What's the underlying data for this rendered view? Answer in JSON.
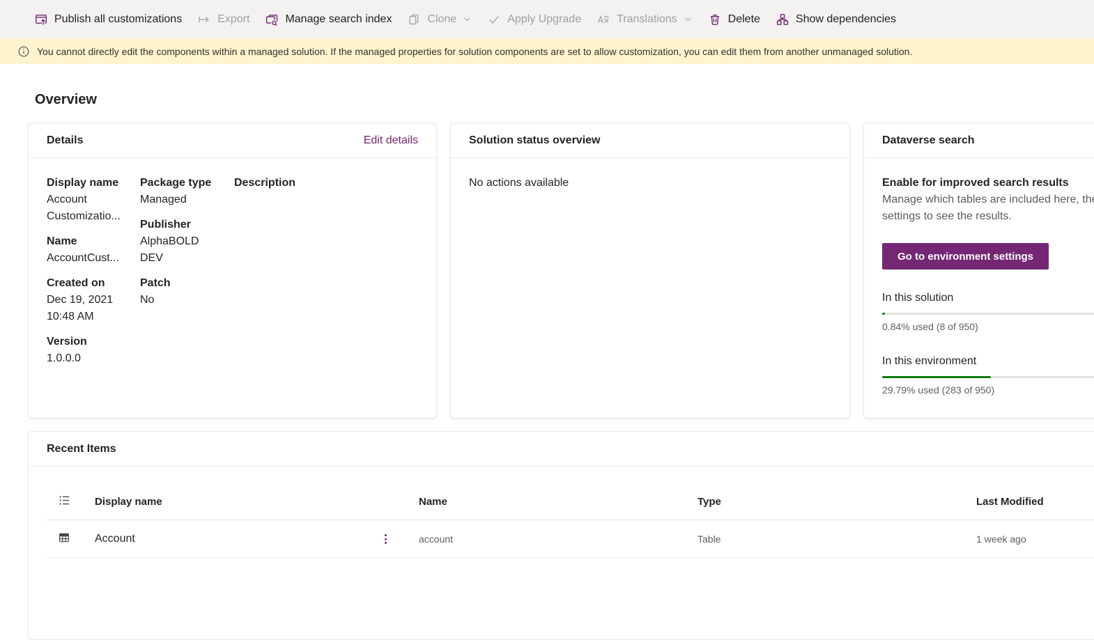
{
  "colors": {
    "accent_purple": "#742774",
    "progress_green": "#107c10",
    "banner_bg": "#fff4ce",
    "toolbar_bg": "#f3f2f1"
  },
  "toolbar": {
    "items": [
      {
        "label": "Publish all customizations",
        "enabled": true,
        "icon": "publish-icon"
      },
      {
        "label": "Export",
        "enabled": false,
        "icon": "export-icon"
      },
      {
        "label": "Manage search index",
        "enabled": true,
        "icon": "search-index-icon"
      },
      {
        "label": "Clone",
        "enabled": false,
        "icon": "clone-icon",
        "chevron": true
      },
      {
        "label": "Apply Upgrade",
        "enabled": false,
        "icon": "checkmark-icon"
      },
      {
        "label": "Translations",
        "enabled": false,
        "icon": "translate-icon",
        "chevron": true
      },
      {
        "label": "Delete",
        "enabled": true,
        "icon": "trash-icon"
      },
      {
        "label": "Show dependencies",
        "enabled": true,
        "icon": "dependencies-icon"
      }
    ]
  },
  "banner": {
    "text": "You cannot directly edit the components within a managed solution. If the managed properties for solution components are set to allow customization, you can edit them from another unmanaged solution."
  },
  "page": {
    "title": "Overview"
  },
  "details_card": {
    "title": "Details",
    "edit_link": "Edit details",
    "columns": [
      {
        "fields": [
          {
            "label": "Display name",
            "lines": [
              "Account",
              "Customizatio..."
            ]
          },
          {
            "label": "Name",
            "lines": [
              "AccountCust..."
            ]
          },
          {
            "label": "Created on",
            "lines": [
              "Dec 19, 2021",
              "10:48 AM"
            ]
          },
          {
            "label": "Version",
            "lines": [
              "1.0.0.0"
            ]
          }
        ]
      },
      {
        "fields": [
          {
            "label": "Package type",
            "lines": [
              "Managed"
            ]
          },
          {
            "label": "Publisher",
            "lines": [
              "AlphaBOLD",
              "DEV"
            ]
          },
          {
            "label": "Patch",
            "lines": [
              "No"
            ]
          }
        ]
      },
      {
        "fields": [
          {
            "label": "Description",
            "lines": []
          }
        ]
      }
    ]
  },
  "status_card": {
    "title": "Solution status overview",
    "empty_text": "No actions available"
  },
  "dataverse_card": {
    "title": "Dataverse search",
    "heading": "Enable for improved search results",
    "description": "Manage which tables are included here, then go to environment settings to see the results.",
    "button_label": "Go to environment settings",
    "solution_usage": {
      "label": "In this solution",
      "percent": 0.84,
      "stats": "0.84% used (8 of 950)"
    },
    "environment_usage": {
      "label": "In this environment",
      "percent": 29.79,
      "stats": "29.79% used (283 of 950)"
    }
  },
  "recent_items": {
    "title": "Recent Items",
    "columns": [
      "Display name",
      "Name",
      "Type",
      "Last Modified"
    ],
    "rows": [
      {
        "display_name": "Account",
        "name": "account",
        "type": "Table",
        "last_modified": "1 week ago"
      }
    ]
  }
}
